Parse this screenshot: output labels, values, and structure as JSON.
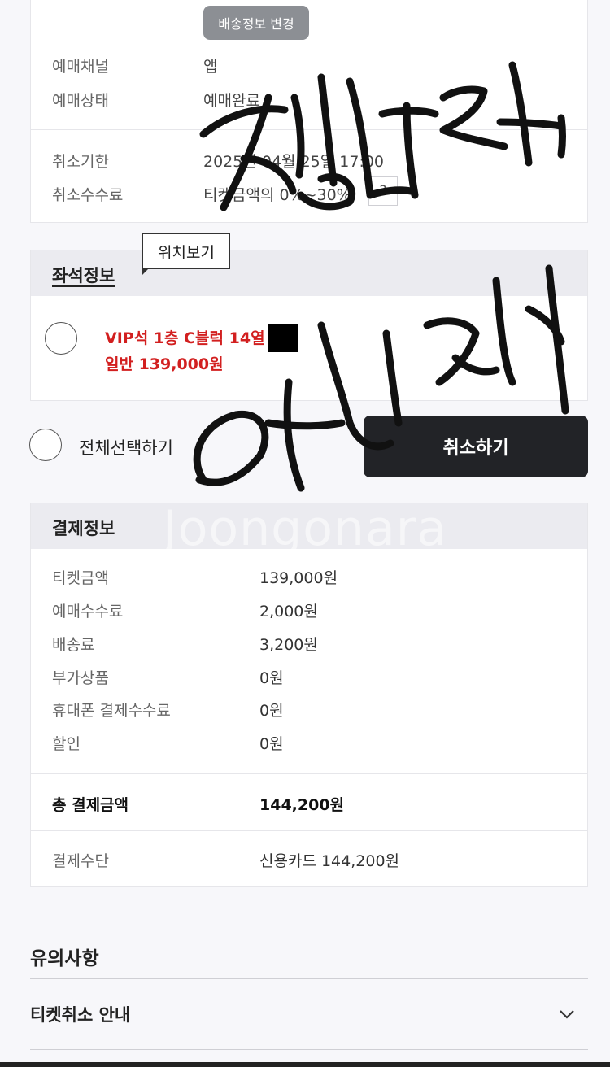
{
  "booking": {
    "delivery_change_button": "배송정보 변경",
    "rows": [
      {
        "label": "예매채널",
        "value": "앱"
      },
      {
        "label": "예매상태",
        "value": "예매완료"
      }
    ],
    "cancel_rows": [
      {
        "label": "취소기한",
        "value": "2025년 04월 25일 17:00"
      },
      {
        "label": "취소수수료",
        "value": "티켓금액의 0%~30%"
      }
    ],
    "help_button": "?"
  },
  "seat": {
    "tooltip": "위치보기",
    "title": "좌석정보",
    "seat_line": "VIP석 1층 C블럭 14열",
    "price_line": "일반 139,000원"
  },
  "actions": {
    "select_all": "전체선택하기",
    "cancel_button": "취소하기"
  },
  "payment": {
    "title": "결제정보",
    "items": [
      {
        "label": "티켓금액",
        "value": "139,000원"
      },
      {
        "label": "예매수수료",
        "value": "2,000원"
      },
      {
        "label": "배송료",
        "value": "3,200원"
      },
      {
        "label": "부가상품",
        "value": "0원"
      },
      {
        "label": "휴대폰 결제수수료",
        "value": "0원"
      },
      {
        "label": "할인",
        "value": "0원"
      }
    ],
    "total_label": "총 결제금액",
    "total_value": "144,200원",
    "method_label": "결제수단",
    "method_value": "신용카드 144,200원"
  },
  "notes": {
    "title": "유의사항",
    "accordion_title": "티켓취소 안내"
  },
  "watermark": "Joongonara"
}
